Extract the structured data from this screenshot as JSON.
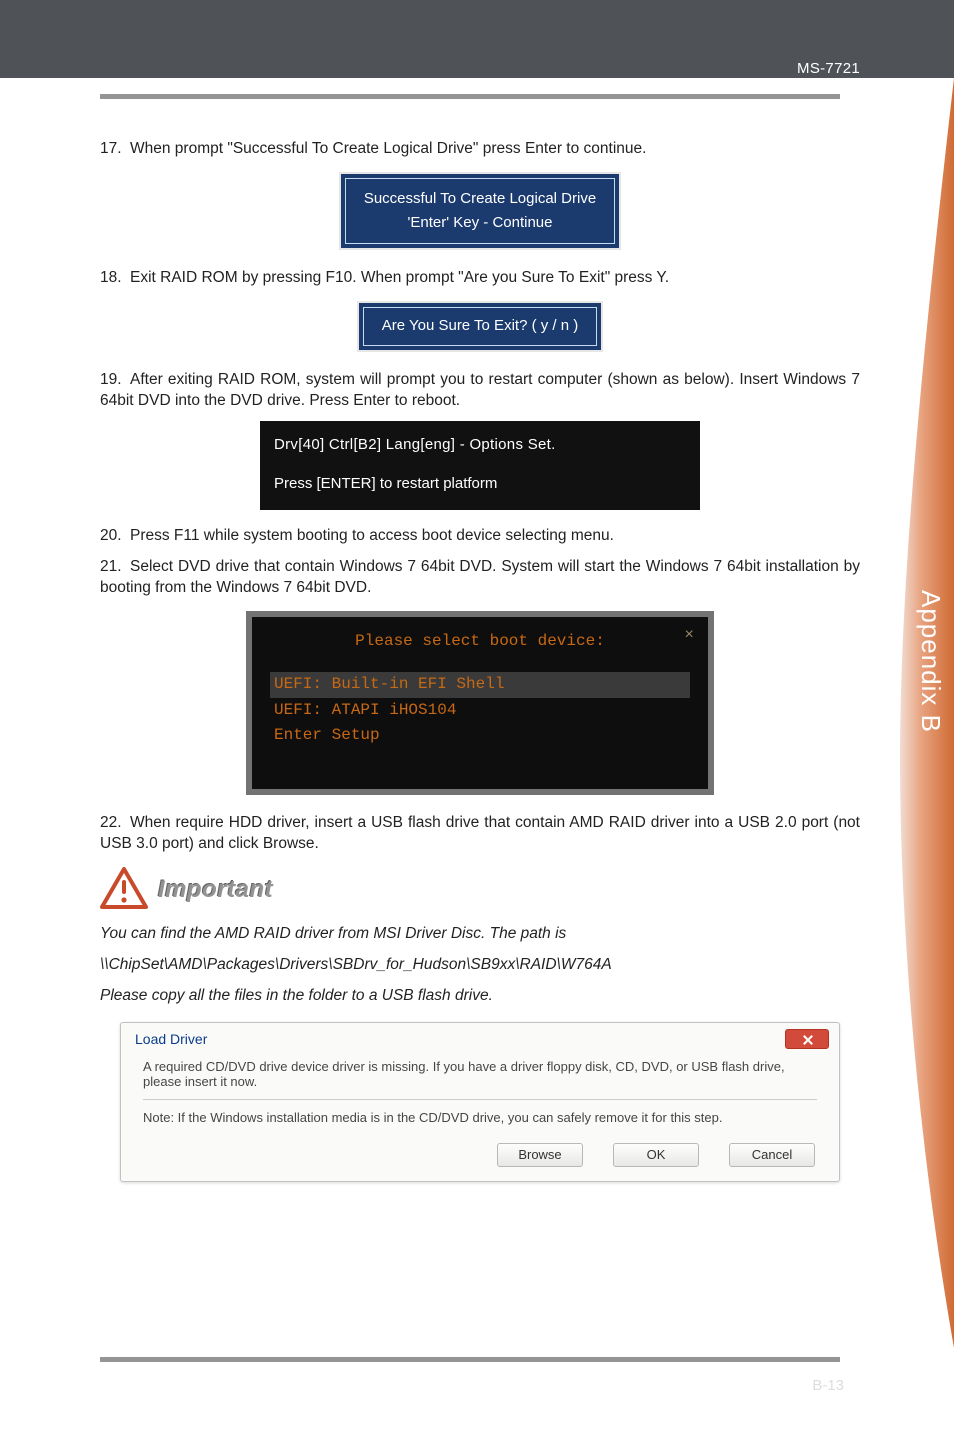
{
  "header": {
    "model": "MS-7721"
  },
  "steps": {
    "s17": {
      "num": "17.",
      "text": "When prompt \"Successful To Create Logical Drive\" press Enter to continue."
    },
    "s18": {
      "num": "18.",
      "text": "Exit RAID ROM by pressing F10. When prompt \"Are you Sure To Exit\" press Y."
    },
    "s19": {
      "num": "19.",
      "text_a": "After exiting RAID ROM, system will prompt you to restart computer (shown as below). Insert Windows 7 64bit DVD into the DVD drive. Press Enter to reboot."
    },
    "s20": {
      "num": "20.",
      "text": "Press F11 while system booting to access boot device selecting menu."
    },
    "s21": {
      "num": "21.",
      "text": "Select DVD drive that contain Windows 7 64bit DVD. System will start the Windows 7 64bit installation by booting from the Windows 7 64bit DVD."
    },
    "s22": {
      "num": "22.",
      "text": "When require HDD driver, insert a USB flash drive that contain AMD RAID driver into a USB 2.0 port (not USB 3.0 port) and click Browse."
    }
  },
  "bluebox1": {
    "line1": "Successful To Create Logical Drive",
    "line2": "'Enter' Key - Continue"
  },
  "bluebox2": {
    "line1": "Are You Sure To Exit? ( y / n )"
  },
  "darkpanel": {
    "line1": "Drv[40]    Ctrl[B2]     Lang[eng]  -  Options Set.",
    "line2": "Press  [ENTER] to restart platform"
  },
  "boot": {
    "title": "Please select boot device:",
    "row_sel": "UEFI: Built-in EFI Shell",
    "row2": "UEFI: ATAPI   iHOS104",
    "row3": "Enter Setup",
    "close": "×"
  },
  "important": {
    "label": "Important"
  },
  "note": {
    "line1": "You can find the AMD RAID driver from MSI Driver Disc. The path is",
    "path": "\\\\ChipSet\\AMD\\Packages\\Drivers\\SBDrv_for_Hudson\\SB9xx\\RAID\\W764A",
    "line2": "Please copy all the files in the folder to a USB flash drive."
  },
  "dialog": {
    "title": "Load Driver",
    "body1": "A required CD/DVD drive device driver is missing. If you have a driver floppy disk, CD, DVD, or USB flash drive, please insert it now.",
    "body2": "Note: If the Windows installation media is in the CD/DVD drive, you can safely remove it for this step.",
    "browse": "Browse",
    "ok": "OK",
    "cancel": "Cancel"
  },
  "side": {
    "label": "Appendix B"
  },
  "footer": {
    "page": "B-13"
  }
}
